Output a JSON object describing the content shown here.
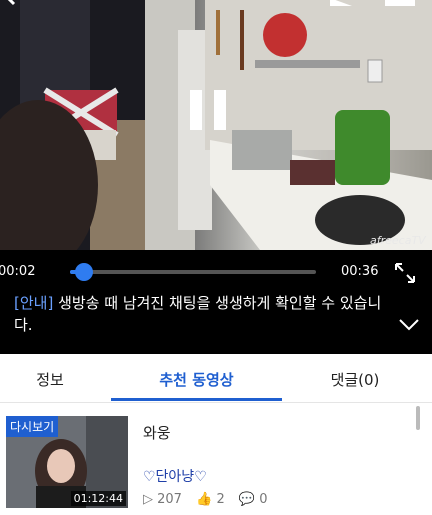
{
  "player": {
    "elapsed": "00:02",
    "total": "00:36",
    "progress": 0.055,
    "watermark": "afreecaTV"
  },
  "notice": {
    "tag": "[안내]",
    "text": " 생방송 때 남겨진 채팅을 생생하게 확인할 수 있습니다."
  },
  "tabs": [
    {
      "label": "정보"
    },
    {
      "label": "추천 동영상"
    },
    {
      "label": "댓글(0)"
    }
  ],
  "active_tab": 1,
  "video_item": {
    "badge": "다시보기",
    "duration": "01:12:44",
    "title": "와웅",
    "author": "♡단아냥♡",
    "views": "207",
    "likes": "2",
    "comments": "0"
  },
  "icons": {
    "back": "chevron-left-icon",
    "pause": "pause-icon",
    "fullscreen": "fullscreen-icon",
    "collapse": "chevron-down-icon"
  },
  "colors": {
    "accent": "#1f5fd0",
    "progress": "#2f7cf0"
  }
}
